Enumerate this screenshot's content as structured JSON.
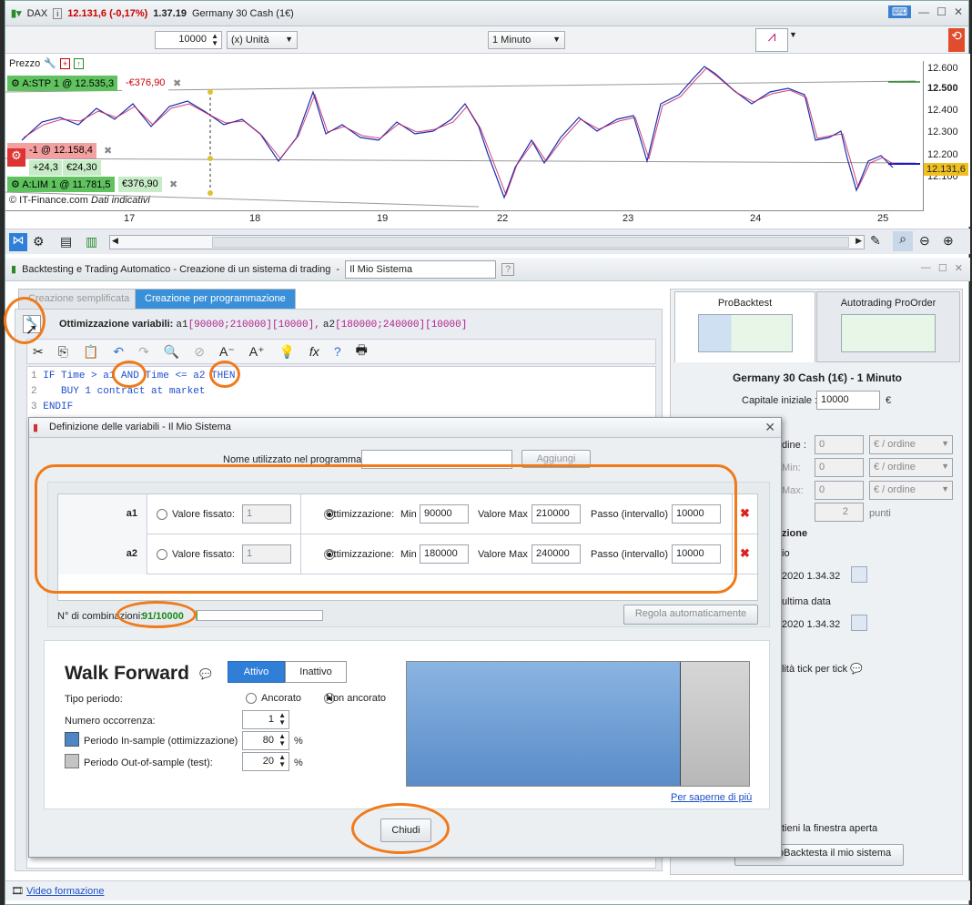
{
  "main_window": {
    "instrument": "DAX",
    "price": "12.131,6 (-0,17%)",
    "time": "1.37.19",
    "instrument_name": "Germany 30 Cash (1€)",
    "quantity": "10000",
    "unit": "(x) Unità",
    "timeframe": "1 Minuto"
  },
  "chart": {
    "panel_title": "Prezzo",
    "copyright": "© IT-Finance.com",
    "disclaimer": "Dati indicativi",
    "x_ticks": [
      "17",
      "18",
      "19",
      "22",
      "23",
      "24",
      "25"
    ],
    "y_ticks": [
      "12.600",
      "12.500",
      "12.400",
      "12.300",
      "12.200",
      "12.100"
    ],
    "current_price": "12.131,6",
    "orders": {
      "stop_label": "A:STP 1 @ 12.535,3",
      "stop_value": "-€376,90",
      "position_label": "-1 @ 12.158,4",
      "position_pts": "+24,3",
      "position_value": "€24,30",
      "limit_label": "A:LIM 1 @ 11.781,5",
      "limit_value": "€376,90"
    }
  },
  "backtest_window": {
    "title": "Backtesting e Trading Automatico - Creazione di un sistema di trading",
    "system_name": "Il Mio Sistema",
    "tab_simple": "Creazione semplificata",
    "tab_programming": "Creazione per programmazione",
    "opt_label": "Ottimizzazione variabili:",
    "opt_a1_name": "a1",
    "opt_a1_range": "[90000;210000][10000],",
    "opt_a2_name": "a2",
    "opt_a2_range": "[180000;240000][10000]",
    "code_lines": [
      {
        "n": "1",
        "text": "IF Time > a1 AND Time <= a2 THEN"
      },
      {
        "n": "2",
        "text": "   BUY 1 contract at market"
      },
      {
        "n": "3",
        "text": "ENDIF"
      }
    ]
  },
  "right_panel": {
    "tab_probacktest": "ProBacktest",
    "tab_autotrading": "Autotrading ProOrder",
    "instrument_title": "Germany 30 Cash (1€) - 1 Minuto",
    "capital_label": "Capitale iniziale :",
    "capital_value": "10000",
    "currency": "€",
    "fee_rows": [
      {
        "label": "dine :",
        "value": "0",
        "unit": "€ / ordine"
      },
      {
        "label": "Min:",
        "value": "0",
        "unit": "€ / ordine"
      },
      {
        "label": "Max:",
        "value": "0",
        "unit": "€ / ordine"
      }
    ],
    "spread_value": "2",
    "spread_unit": "punti",
    "section_label": "zione",
    "start_label": "io",
    "start_date": "2020 1.34.32",
    "end_label": "ultima data",
    "end_date": "2020 1.34.32",
    "tick_label": "lità tick per tick",
    "keep_open": "tieni la finestra aperta",
    "run_button": "ProBacktesta il mio sistema"
  },
  "dialog": {
    "title": "Definizione delle variabili - Il Mio Sistema",
    "name_label": "Nome utilizzato nel programma",
    "add_button": "Aggiungi",
    "variables": [
      {
        "name": "a1",
        "fixed_label": "Valore fissato:",
        "fixed": "1",
        "opt_label": "Ottimizzazione:",
        "min_label": "Min",
        "min": "90000",
        "max_label": "Valore Max",
        "max": "210000",
        "step_label": "Passo (intervallo)",
        "step": "10000"
      },
      {
        "name": "a2",
        "fixed_label": "Valore fissato:",
        "fixed": "1",
        "opt_label": "Ottimizzazione:",
        "min_label": "Min",
        "min": "180000",
        "max_label": "Valore Max",
        "max": "240000",
        "step_label": "Passo (intervallo)",
        "step": "10000"
      }
    ],
    "combinations_label": "N° di combinazioni:",
    "combinations_value": "91/10000",
    "combinations_fraction": 0.0091,
    "auto_adjust": "Regola automaticamente",
    "walk_forward": {
      "title": "Walk Forward",
      "active": "Attivo",
      "inactive": "Inattivo",
      "period_type_label": "Tipo periodo:",
      "anchored": "Ancorato",
      "not_anchored": "Non ancorato",
      "occurrences_label": "Numero occorrenza:",
      "occurrences": "1",
      "in_sample_label": "Periodo In-sample (ottimizzazione)",
      "in_sample": "80",
      "out_sample_label": "Periodo Out-of-sample (test):",
      "out_sample": "20",
      "percent": "%",
      "learn_more": "Per saperne di più"
    },
    "close_button": "Chiudi"
  },
  "footer": {
    "video_link": "Video formazione"
  },
  "colors": {
    "accent": "#2f7fd8",
    "annotation": "#f07a1a",
    "in_sample_bar": "#7aa8d8",
    "out_sample_bar": "#c4c4c4"
  }
}
